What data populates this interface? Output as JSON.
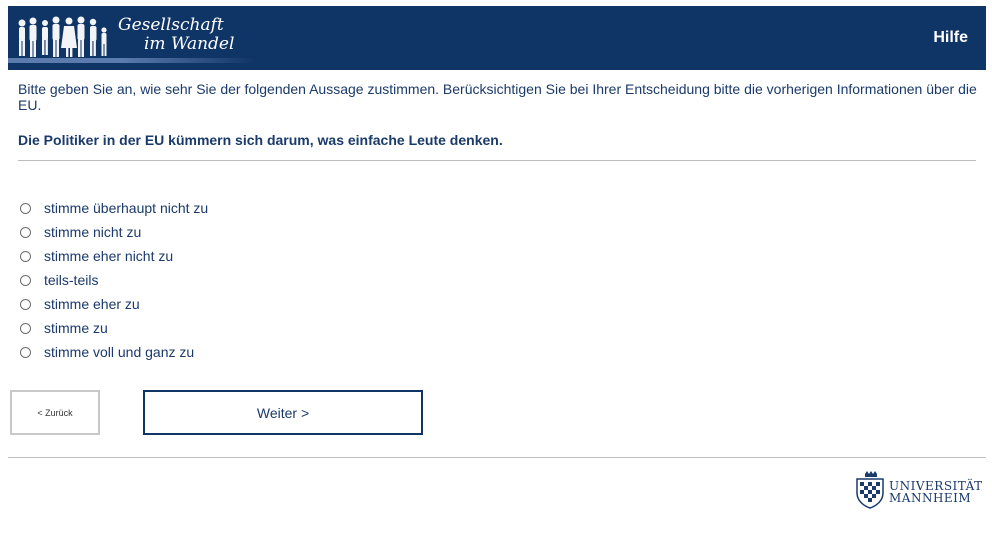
{
  "header": {
    "logo_line1": "Gesellschaft",
    "logo_line2": "im Wandel",
    "help_label": "Hilfe"
  },
  "survey": {
    "intro": "Bitte geben Sie an, wie sehr Sie der folgenden Aussage zustimmen. Berücksichtigen Sie bei Ihrer Entscheidung bitte die vorherigen Informationen über die EU.",
    "question": "Die Politiker in der EU kümmern sich darum, was einfache Leute denken.",
    "options": [
      "stimme überhaupt nicht zu",
      "stimme nicht zu",
      "stimme eher nicht zu",
      "teils-teils",
      "stimme eher zu",
      "stimme zu",
      "stimme voll und ganz zu"
    ]
  },
  "nav": {
    "back_label": "< Zurück",
    "next_label": "Weiter >"
  },
  "footer": {
    "university_line1": "UNIVERSITÄT",
    "university_line2": "MANNHEIM"
  },
  "colors": {
    "brand_navy": "#0f3466",
    "text_navy": "#1a3a6b"
  }
}
